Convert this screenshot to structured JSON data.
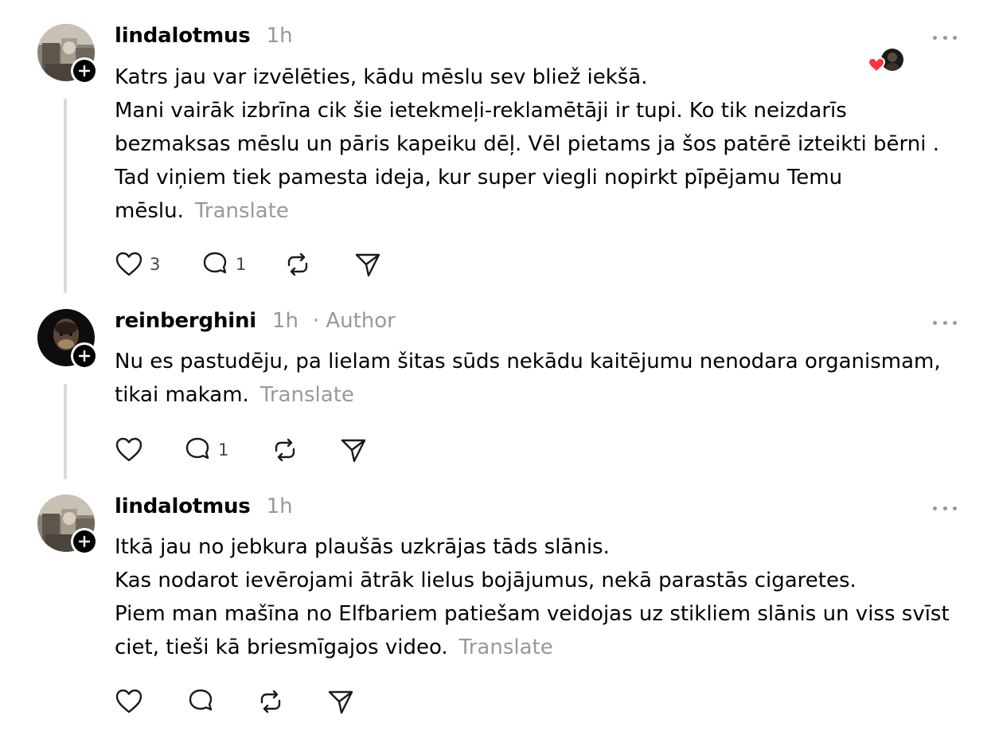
{
  "posts": [
    {
      "username": "lindalotmus",
      "time": "1h",
      "author_label": "",
      "paragraphs": [
        "Katrs jau var izvēlēties, kādu mēslu sev bliež iekšā.",
        "Mani vairāk izbrīna cik šie ietekmeļi-reklamētāji ir tupi. Ko tik neizdarīs bezmaksas mēslu un pāris kapeiku dēļ. Vēl pietams ja šos patērē izteikti bērni . Tad viņiem tiek pamesta ideja, kur super viegli nopirkt pīpējamu Temu mēslu."
      ],
      "translate": "Translate",
      "likes": "3",
      "replies": "1",
      "has_liker": true
    },
    {
      "username": "reinberghini",
      "time": "1h",
      "separator": "·",
      "author_label": "Author",
      "paragraphs": [
        "Nu es pastudēju, pa lielam šitas sūds nekādu kaitējumu nenodara organismam, tikai makam."
      ],
      "translate": "Translate",
      "likes": "",
      "replies": "1",
      "has_liker": false
    },
    {
      "username": "lindalotmus",
      "time": "1h",
      "author_label": "",
      "paragraphs": [
        "Itkā jau no jebkura plaušās uzkrājas tāds slānis.",
        "Kas nodarot ievērojami ātrāk lielus bojājumus, nekā parastās cigaretes.",
        "Piem man mašīna no Elfbariem patiešam veidojas uz stikliem slānis un viss svīst ciet, tieši kā briesmīgajos video."
      ],
      "translate": "Translate",
      "likes": "",
      "replies": "",
      "has_liker": false
    }
  ],
  "icons": {
    "like": "heart-icon",
    "reply": "comment-icon",
    "repost": "repost-icon",
    "share": "send-icon",
    "more": "more-icon",
    "follow": "plus-icon"
  },
  "colors": {
    "muted": "#999999",
    "thread_line": "#d9d9d9",
    "like_red": "#ff3040"
  }
}
